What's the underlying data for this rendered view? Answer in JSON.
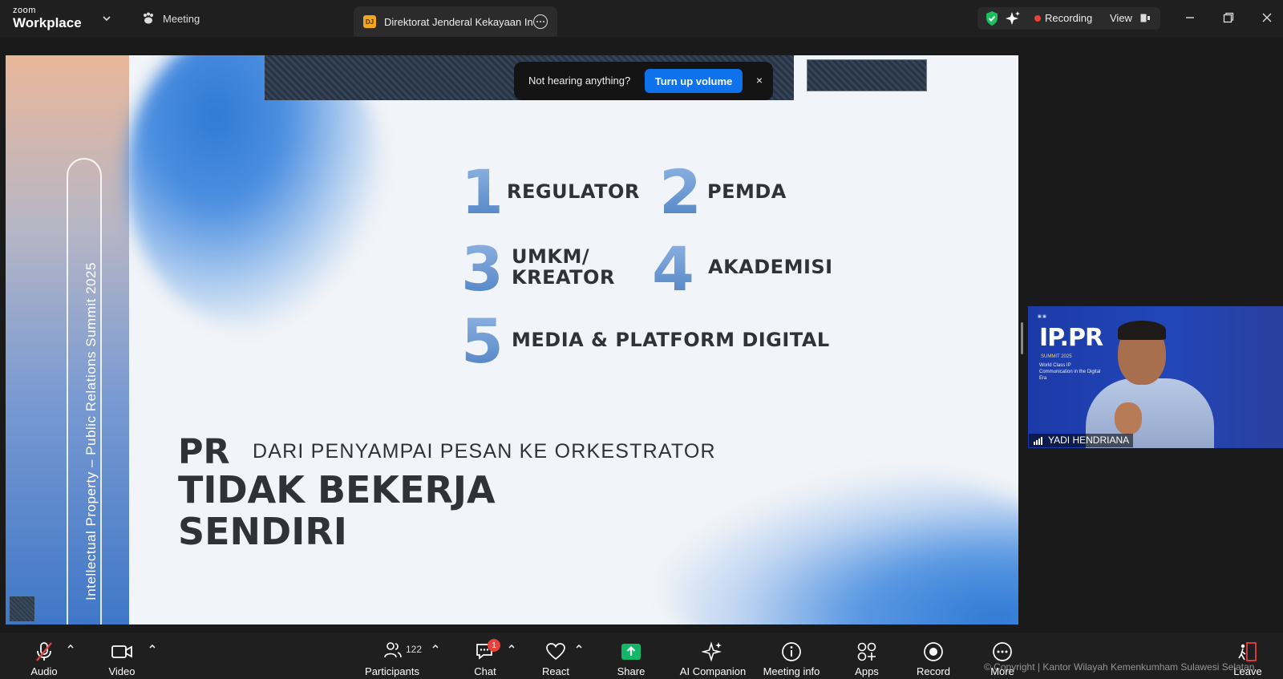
{
  "titlebar": {
    "brand_top": "zoom",
    "brand_main": "Workplace",
    "meeting_tab": "Meeting",
    "doc_tab_badge": "DJ",
    "doc_tab_title": "Direktorat Jenderal Kekayaan Inte",
    "recording_label": "Recording",
    "view_label": "View"
  },
  "notice": {
    "message": "Not hearing anything?",
    "button": "Turn up volume",
    "close": "×"
  },
  "slide": {
    "sidebar_text": "Intellectual Property – Public Relations Summit 2025",
    "items": [
      {
        "num": "1",
        "label": "REGULATOR"
      },
      {
        "num": "2",
        "label": "PEMDA"
      },
      {
        "num": "3",
        "label_line1": "UMKM/",
        "label_line2": "KREATOR"
      },
      {
        "num": "4",
        "label": "AKADEMISI"
      },
      {
        "num": "5",
        "label": "MEDIA & PLATFORM DIGITAL"
      }
    ],
    "pr": "PR",
    "subtitle": "DARI PENYAMPAI PESAN KE ORKESTRATOR",
    "headline_line1": "TIDAK BEKERJA",
    "headline_line2": "SENDIRI"
  },
  "self_view": {
    "logo_ip": "IP.PR",
    "summit": "SUMMIT 2025",
    "tagline": "World Class IP Communication in the Digital Era",
    "participant_name": "YADI HENDRIANA"
  },
  "toolbar": {
    "audio": "Audio",
    "video": "Video",
    "participants": "Participants",
    "participants_count": "122",
    "chat": "Chat",
    "chat_badge": "1",
    "react": "React",
    "share": "Share",
    "ai_companion": "AI Companion",
    "meeting_info": "Meeting info",
    "apps": "Apps",
    "record": "Record",
    "more": "More",
    "leave": "Leave",
    "copyright": "© Copyright | Kantor Wilayah Kemenkumham Sulawesi Selatan"
  },
  "colors": {
    "accent_blue": "#0e72ed",
    "recording_red": "#e8403a",
    "share_green": "#12b76a",
    "shield_green": "#1dbf5f",
    "leave_red": "#e8403a"
  }
}
